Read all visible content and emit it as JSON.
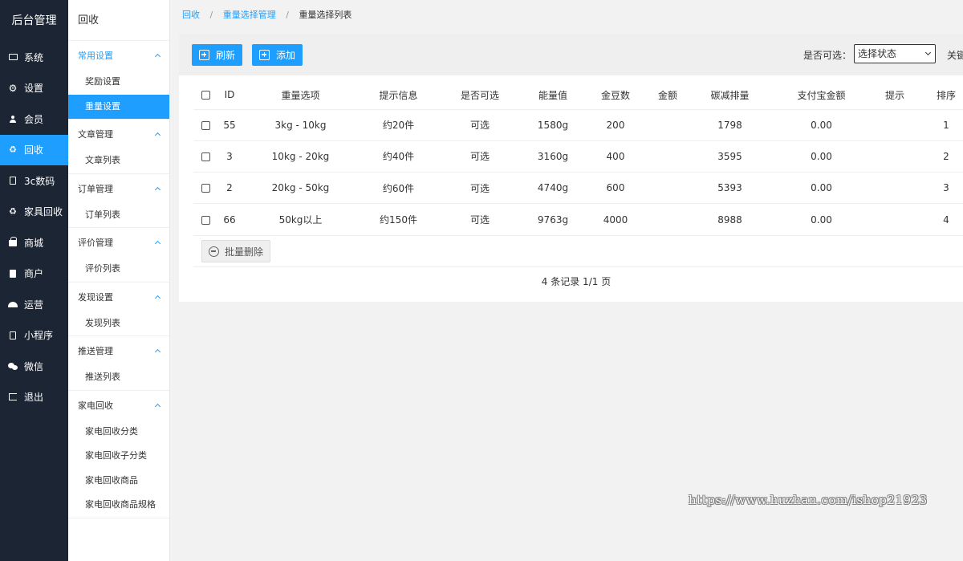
{
  "brand": "后台管理",
  "nav": [
    {
      "label": "系统",
      "icon": "monitor-icon"
    },
    {
      "label": "设置",
      "icon": "gear-icon"
    },
    {
      "label": "会员",
      "icon": "user-icon"
    },
    {
      "label": "回收",
      "icon": "recycle-icon",
      "active": true
    },
    {
      "label": "3c数码",
      "icon": "device-icon"
    },
    {
      "label": "家具回收",
      "icon": "recycle-icon"
    },
    {
      "label": "商城",
      "icon": "shopping-bag-icon"
    },
    {
      "label": "商户",
      "icon": "document-icon"
    },
    {
      "label": "运营",
      "icon": "dashboard-icon"
    },
    {
      "label": "小程序",
      "icon": "mini-program-icon"
    },
    {
      "label": "微信",
      "icon": "wechat-icon"
    },
    {
      "label": "退出",
      "icon": "logout-icon"
    }
  ],
  "subnav": {
    "title": "回收",
    "groups": [
      {
        "title": "常用设置",
        "items": [
          "奖励设置",
          "重量设置"
        ]
      },
      {
        "title": "文章管理",
        "items": [
          "文章列表"
        ]
      },
      {
        "title": "订单管理",
        "items": [
          "订单列表"
        ]
      },
      {
        "title": "评价管理",
        "items": [
          "评价列表"
        ]
      },
      {
        "title": "发现设置",
        "items": [
          "发现列表"
        ]
      },
      {
        "title": "推送管理",
        "items": [
          "推送列表"
        ]
      },
      {
        "title": "家电回收",
        "items": [
          "家电回收分类",
          "家电回收子分类",
          "家电回收商品",
          "家电回收商品规格"
        ]
      }
    ]
  },
  "breadcrumb": {
    "level1": "回收",
    "level2": "重量选择管理",
    "current": "重量选择列表",
    "separator": "/"
  },
  "toolbar": {
    "refresh_label": "刷新",
    "add_label": "添加",
    "filter_label": "是否可选：",
    "filter_value": "选择状态",
    "keyword_label": "关键"
  },
  "table": {
    "headers": [
      "ID",
      "重量选项",
      "提示信息",
      "是否可选",
      "能量值",
      "金豆数",
      "金额",
      "碳减排量",
      "支付宝金额",
      "提示",
      "排序"
    ],
    "rows": [
      [
        "55",
        "3kg - 10kg",
        "约20件",
        "可选",
        "1580g",
        "200",
        "",
        "1798",
        "0.00",
        "",
        "1"
      ],
      [
        "3",
        "10kg - 20kg",
        "约40件",
        "可选",
        "3160g",
        "400",
        "",
        "3595",
        "0.00",
        "",
        "2"
      ],
      [
        "2",
        "20kg - 50kg",
        "约60件",
        "可选",
        "4740g",
        "600",
        "",
        "5393",
        "0.00",
        "",
        "3"
      ],
      [
        "66",
        "50kg以上",
        "约150件",
        "可选",
        "9763g",
        "4000",
        "",
        "8988",
        "0.00",
        "",
        "4"
      ]
    ]
  },
  "batch_delete_label": "批量删除",
  "pager_text": "4 条记录 1/1 页",
  "watermark": "https://www.huzhan.com/ishop21923",
  "colors": {
    "accent": "#1e9fff",
    "sidebar": "#1c2533"
  }
}
